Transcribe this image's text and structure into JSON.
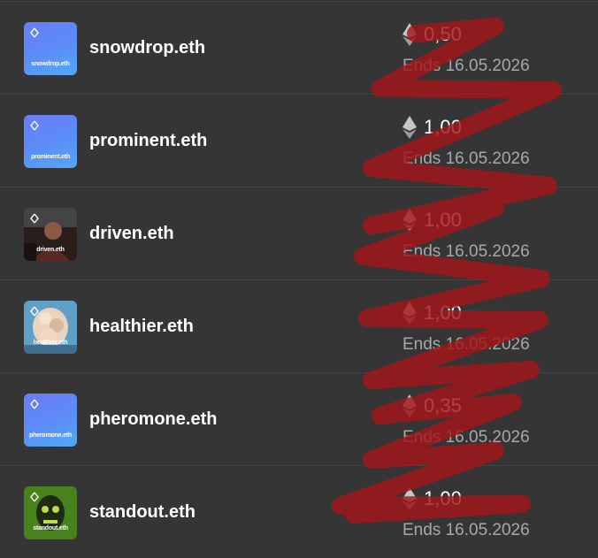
{
  "listings": [
    {
      "name": "snowdrop.eth",
      "thumb_label": "snowdrop.eth",
      "thumb_style": "gradient",
      "price": "0,50",
      "ends": "Ends 16.05.2026"
    },
    {
      "name": "prominent.eth",
      "thumb_label": "prominent.eth",
      "thumb_style": "gradient",
      "price": "1,00",
      "ends": "Ends 16.05.2026"
    },
    {
      "name": "driven.eth",
      "thumb_label": "driven.eth",
      "thumb_style": "photo-dark",
      "price": "1,00",
      "ends": "Ends 16.05.2026"
    },
    {
      "name": "healthier.eth",
      "thumb_label": "healthier.eth",
      "thumb_style": "photo-light",
      "price": "1,00",
      "ends": "Ends 16.05.2026"
    },
    {
      "name": "pheromone.eth",
      "thumb_label": "pheromone.eth",
      "thumb_style": "gradient",
      "price": "0,35",
      "ends": "Ends 16.05.2026"
    },
    {
      "name": "standout.eth",
      "thumb_label": "standout.eth",
      "thumb_style": "photo-green",
      "price": "1,00",
      "ends": "Ends 16.05.2026"
    }
  ],
  "icons": {
    "currency": "ethereum-icon",
    "avatar_mark": "ens-logo-icon"
  },
  "colors": {
    "background": "#353535",
    "divider": "#444444",
    "scribble": "#a3161b",
    "ends_text": "#a8a8a8"
  }
}
